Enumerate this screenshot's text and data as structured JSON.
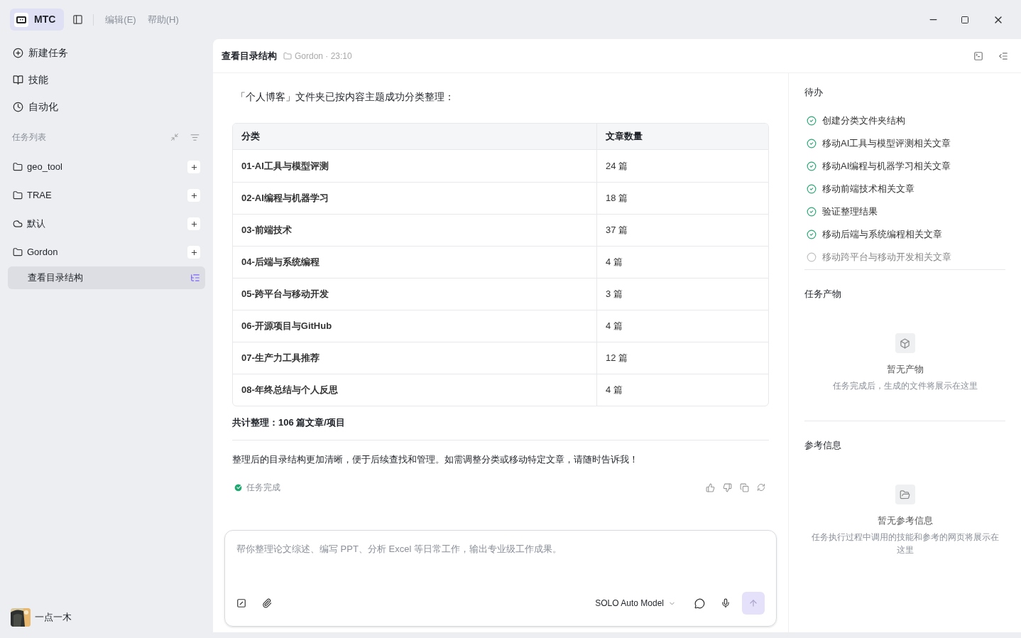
{
  "titlebar": {
    "app_name": "MTC",
    "menus": [
      "编辑(E)",
      "帮助(H)"
    ]
  },
  "sidebar": {
    "nav": [
      {
        "kind": "new",
        "label": "新建任务"
      },
      {
        "kind": "skills",
        "label": "技能"
      },
      {
        "kind": "auto",
        "label": "自动化"
      }
    ],
    "section_title": "任务列表",
    "groups": [
      {
        "kind": "folder",
        "label": "geo_tool"
      },
      {
        "kind": "folder",
        "label": "TRAE"
      },
      {
        "kind": "cloud",
        "label": "默认"
      },
      {
        "kind": "folder",
        "label": "Gordon",
        "children": [
          {
            "label": "查看目录结构",
            "selected": true
          }
        ]
      }
    ],
    "user": {
      "name": "一点一木"
    }
  },
  "header": {
    "title": "查看目录结构",
    "meta": "Gordon · 23:10"
  },
  "message": {
    "intro": "「个人博客」文件夹已按内容主题成功分类整理：",
    "table": {
      "columns": [
        "分类",
        "文章数量"
      ],
      "rows": [
        [
          "01-AI工具与模型评测",
          "24 篇"
        ],
        [
          "02-AI编程与机器学习",
          "18 篇"
        ],
        [
          "03-前端技术",
          "37 篇"
        ],
        [
          "04-后端与系统编程",
          "4 篇"
        ],
        [
          "05-跨平台与移动开发",
          "3 篇"
        ],
        [
          "06-开源项目与GitHub",
          "4 篇"
        ],
        [
          "07-生产力工具推荐",
          "12 篇"
        ],
        [
          "08-年终总结与个人反思",
          "4 篇"
        ]
      ]
    },
    "total": "共计整理：106 篇文章/项目",
    "outro": "整理后的目录结构更加清晰，便于后续查找和管理。如需调整分类或移动特定文章，请随时告诉我！",
    "status": "任务完成"
  },
  "composer": {
    "placeholder": "帮你整理论文综述、编写 PPT、分析 Excel 等日常工作，输出专业级工作成果。",
    "model": "SOLO Auto Model"
  },
  "panel": {
    "todo_title": "待办",
    "todos": [
      {
        "label": "创建分类文件夹结构",
        "done": true
      },
      {
        "label": "移动AI工具与模型评测相关文章",
        "done": true
      },
      {
        "label": "移动AI编程与机器学习相关文章",
        "done": true
      },
      {
        "label": "移动前端技术相关文章",
        "done": true
      },
      {
        "label": "验证整理结果",
        "done": true
      },
      {
        "label": "移动后端与系统编程相关文章",
        "done": true
      },
      {
        "label": "移动跨平台与移动开发相关文章",
        "done": false
      }
    ],
    "outputs": {
      "title": "任务产物",
      "empty_title": "暂无产物",
      "empty_text": "任务完成后，生成的文件将展示在这里"
    },
    "refs": {
      "title": "参考信息",
      "empty_title": "暂无参考信息",
      "empty_text": "任务执行过程中调用的技能和参考的网页将展示在这里"
    }
  }
}
